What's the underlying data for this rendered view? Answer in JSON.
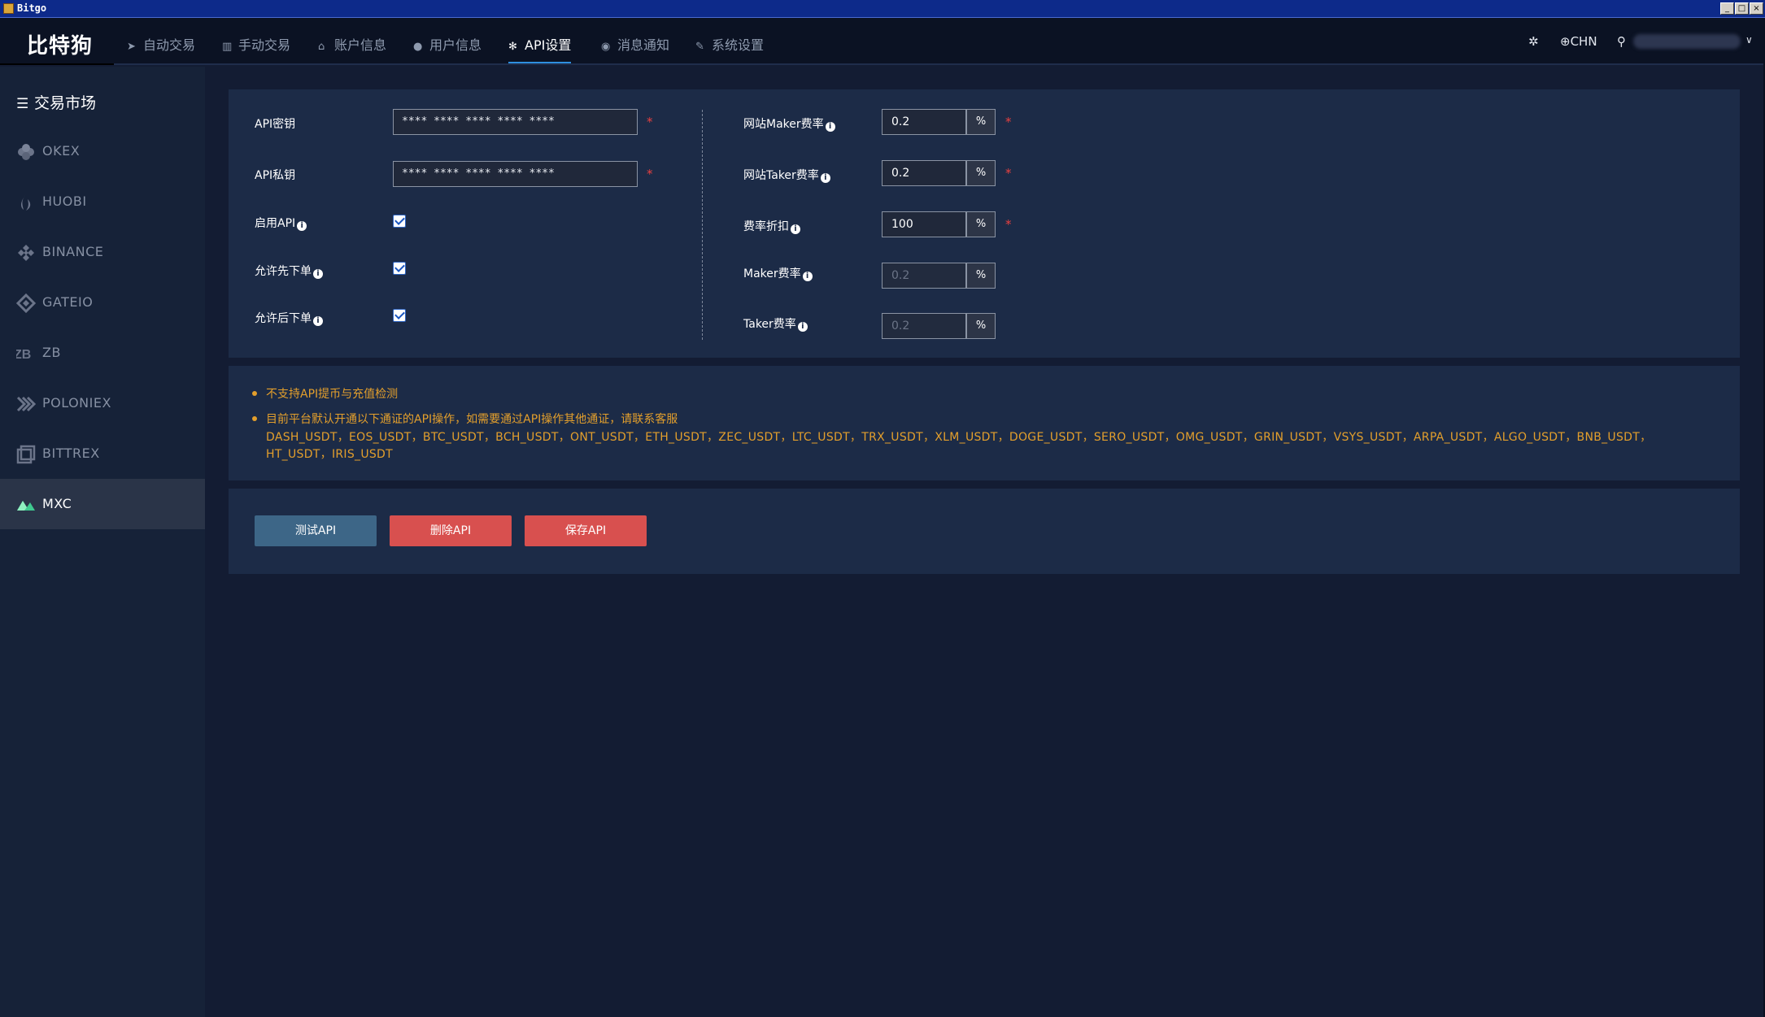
{
  "window": {
    "title": "Bitgo"
  },
  "nav": {
    "logo": "比特狗",
    "menu": [
      {
        "label": "自动交易",
        "icon": "send-icon"
      },
      {
        "label": "手动交易",
        "icon": "chart-icon"
      },
      {
        "label": "账户信息",
        "icon": "bank-icon"
      },
      {
        "label": "用户信息",
        "icon": "user-icon"
      },
      {
        "label": "API设置",
        "icon": "cogs-icon"
      },
      {
        "label": "消息通知",
        "icon": "comment-icon"
      },
      {
        "label": "系统设置",
        "icon": "wrench-icon"
      }
    ],
    "language": "CHN",
    "settings_icon": "gear-icon",
    "user_icon": "user-icon"
  },
  "sidebar": {
    "title": "交易市场",
    "items": [
      {
        "label": "OKEX",
        "icon": "okex-icon"
      },
      {
        "label": "HUOBI",
        "icon": "huobi-icon"
      },
      {
        "label": "BINANCE",
        "icon": "binance-icon"
      },
      {
        "label": "GATEIO",
        "icon": "gateio-icon"
      },
      {
        "label": "ZB",
        "icon": "zb-icon"
      },
      {
        "label": "POLONIEX",
        "icon": "poloniex-icon"
      },
      {
        "label": "BITTREX",
        "icon": "bittrex-icon"
      },
      {
        "label": "MXC",
        "icon": "mxc-icon"
      }
    ],
    "active": "MXC"
  },
  "form": {
    "api_key": {
      "label": "API密钥",
      "value": "**** **** **** **** ****"
    },
    "api_secret": {
      "label": "API私钥",
      "value": "**** **** **** **** ****"
    },
    "enable_api": {
      "label": "启用API",
      "checked": true
    },
    "allow_pre_order": {
      "label": "允许先下单",
      "checked": true
    },
    "allow_post_order": {
      "label": "允许后下单",
      "checked": true
    },
    "site_maker_fee": {
      "label": "网站Maker费率",
      "value": "0.2",
      "unit": "%"
    },
    "site_taker_fee": {
      "label": "网站Taker费率",
      "value": "0.2",
      "unit": "%"
    },
    "fee_discount": {
      "label": "费率折扣",
      "value": "100",
      "unit": "%"
    },
    "maker_fee": {
      "label": "Maker费率",
      "placeholder": "0.2",
      "unit": "%"
    },
    "taker_fee": {
      "label": "Taker费率",
      "placeholder": "0.2",
      "unit": "%"
    },
    "required_mark": "*"
  },
  "notices": {
    "line1": "不支持API提币与充值检测",
    "line2": "目前平台默认开通以下通证的API操作，如需要通过API操作其他通证，请联系客服",
    "pairs": "DASH_USDT，EOS_USDT，BTC_USDT，BCH_USDT，ONT_USDT，ETH_USDT，ZEC_USDT，LTC_USDT，TRX_USDT，XLM_USDT，DOGE_USDT，SERO_USDT，OMG_USDT，GRIN_USDT，VSYS_USDT，ARPA_USDT，ALGO_USDT，BNB_USDT，HT_USDT，IRIS_USDT"
  },
  "buttons": {
    "test": "测试API",
    "delete": "删除API",
    "save": "保存API"
  },
  "colors": {
    "background": "#131c33",
    "panel": "#1c2b47",
    "active_tab": "#2f8fe0",
    "notice": "#e39f2c",
    "danger": "#d8504f",
    "test_button": "#3d6687"
  }
}
